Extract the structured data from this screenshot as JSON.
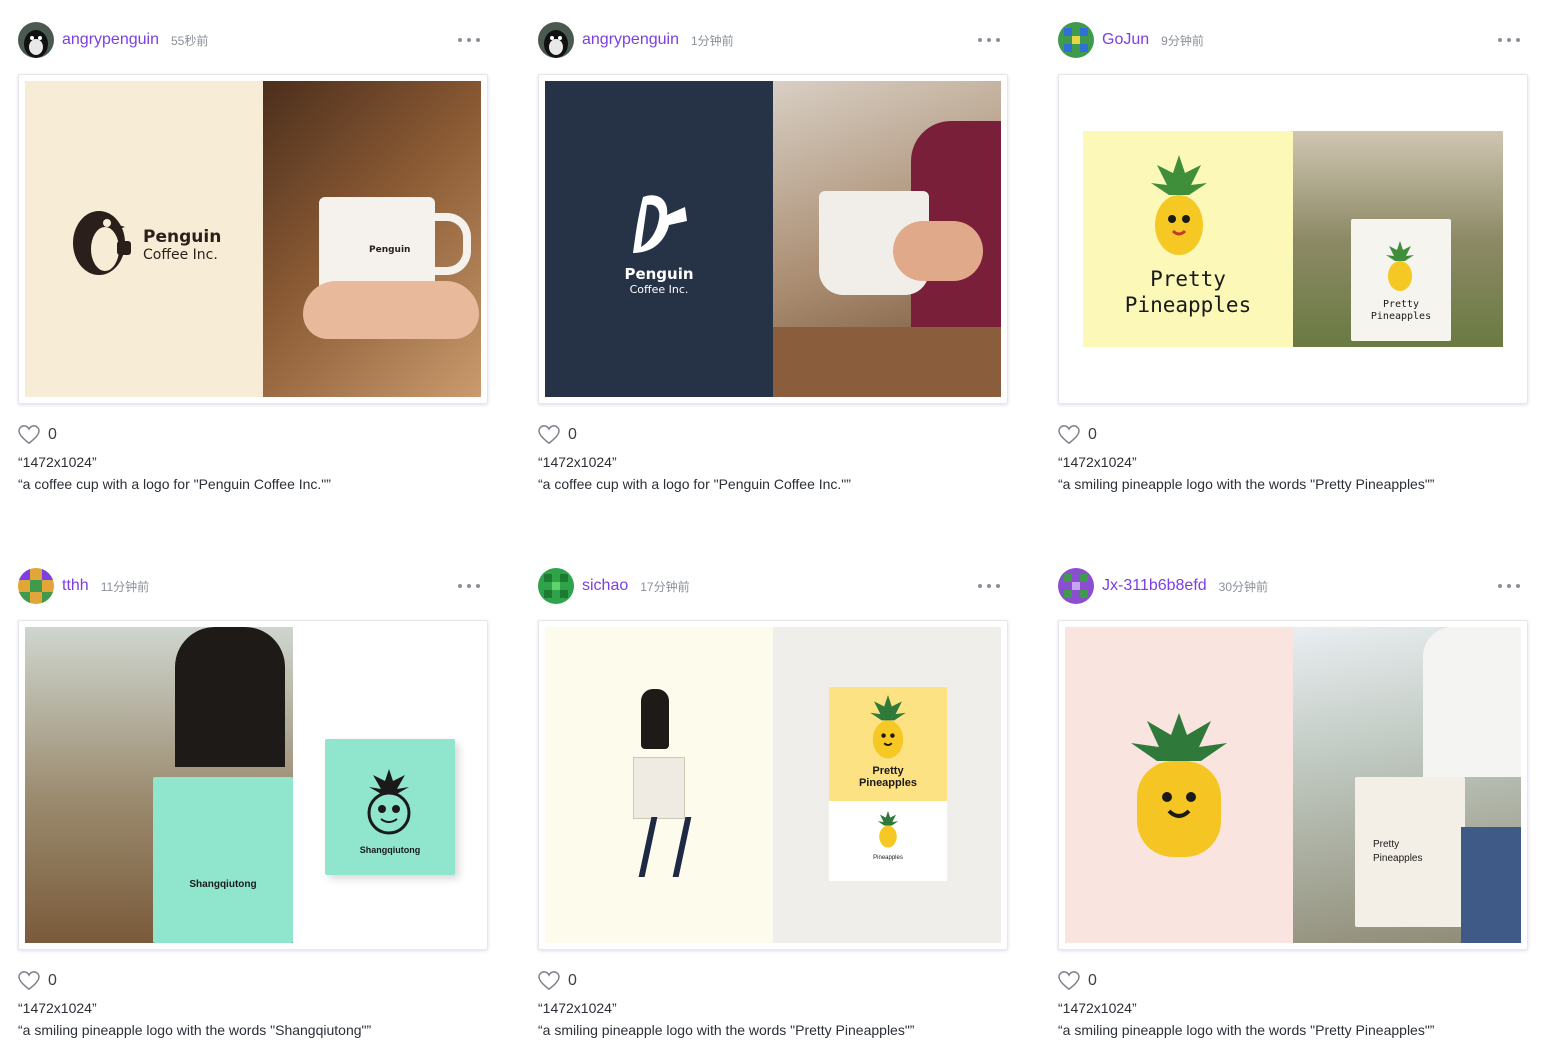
{
  "posts": [
    {
      "username": "angrypenguin",
      "time": "55秒前",
      "likes": "0",
      "size": "“1472x1024”",
      "prompt": "“a coffee cup with a logo for \"Penguin Coffee Inc.\"”",
      "logo_line1": "Penguin",
      "logo_line2": "Coffee Inc."
    },
    {
      "username": "angrypenguin",
      "time": "1分钟前",
      "likes": "0",
      "size": "“1472x1024”",
      "prompt": "“a coffee cup with a logo for \"Penguin Coffee Inc.\"”",
      "logo_line1": "Penguin",
      "logo_line2": "Coffee Inc."
    },
    {
      "username": "GoJun",
      "time": "9分钟前",
      "likes": "0",
      "size": "“1472x1024”",
      "prompt": "“a smiling pineapple logo with the words \"Pretty Pineapples\"”",
      "logo_line1": "Pretty",
      "logo_line2": "Pineapples"
    },
    {
      "username": "tthh",
      "time": "11分钟前",
      "likes": "0",
      "size": "“1472x1024”",
      "prompt": "“a smiling pineapple logo with the words \"Shangqiutong\"”",
      "logo_line1": "Shangqiutong"
    },
    {
      "username": "sichao",
      "time": "17分钟前",
      "likes": "0",
      "size": "“1472x1024”",
      "prompt": "“a smiling pineapple logo with the words \"Pretty Pineapples\"”",
      "logo_line1": "Pretty",
      "logo_line2": "Pineapples",
      "logo_line3": "Pineapples"
    },
    {
      "username": "Jx-311b6b8efd",
      "time": "30分钟前",
      "likes": "0",
      "size": "“1472x1024”",
      "prompt": "“a smiling pineapple logo with the words \"Pretty Pineapples\"”",
      "logo_line1": "Pretty",
      "logo_line2": "Pineapples"
    }
  ],
  "colors": {
    "username": "#7b3fe4",
    "meta": "#8a8f98"
  }
}
